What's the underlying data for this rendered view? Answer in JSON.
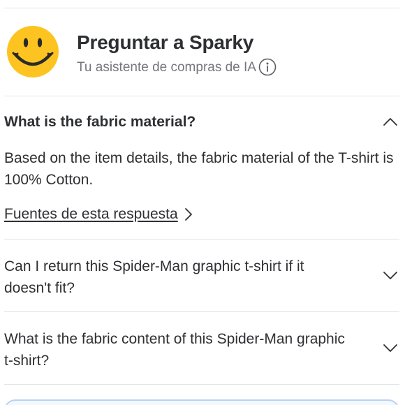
{
  "header": {
    "title": "Preguntar a Sparky",
    "subtitle": "Tu asistente de compras de IA",
    "avatar_icon": "smiley-face-icon",
    "info_icon": "info-circle-icon"
  },
  "faq": {
    "open_item": {
      "question": "What is the fabric material?",
      "answer": "Based on the item details, the fabric material of the T-shirt is 100% Cotton.",
      "sources_label": "Fuentes de esta respuesta",
      "expanded": true
    },
    "items": [
      {
        "question": "Can I return this Spider-Man graphic t-shirt if it doesn't fit?",
        "expanded": false
      },
      {
        "question": "What is the fabric content of this Spider-Man graphic t-shirt?",
        "expanded": false
      }
    ]
  },
  "colors": {
    "avatar_yellow": "#fdc421",
    "text": "#2e2f32",
    "muted_text": "#74767c",
    "divider": "#e3e4e5",
    "input_border": "#b9d3ee"
  }
}
